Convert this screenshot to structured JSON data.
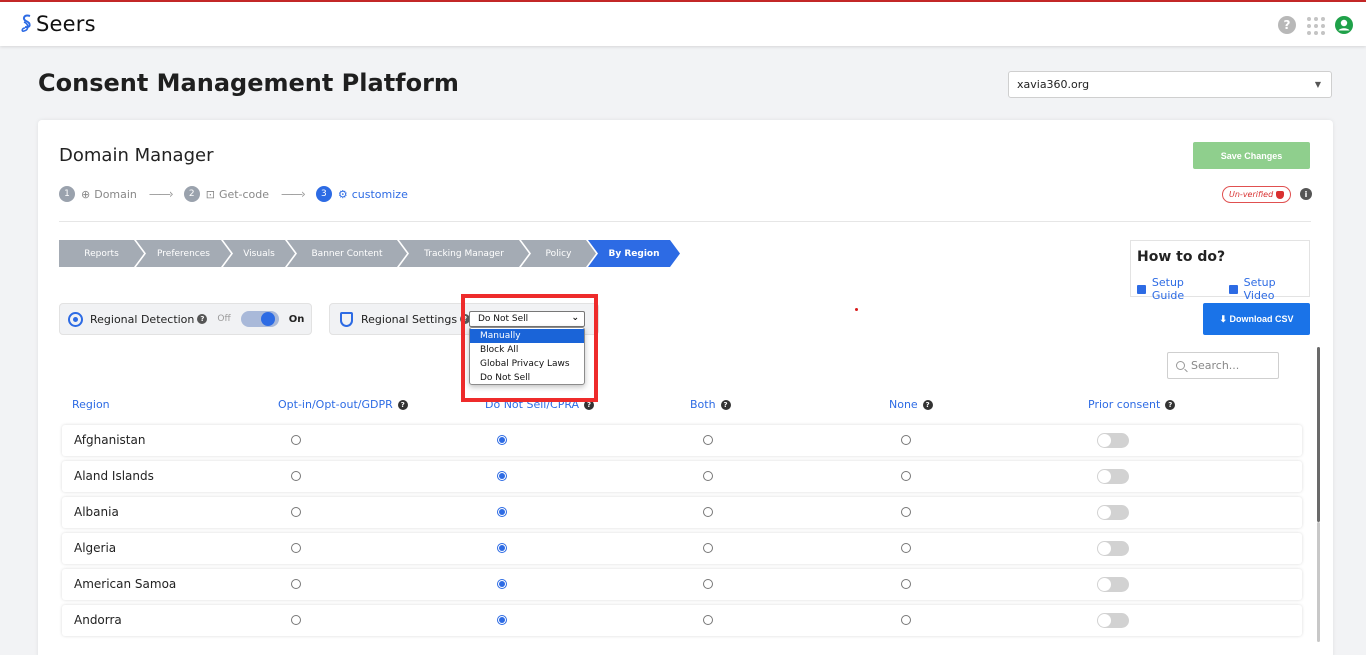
{
  "app": {
    "logo_text": "Seers"
  },
  "header": {
    "title": "Consent Management Platform",
    "domain_value": "xavia360.org"
  },
  "card": {
    "title": "Domain Manager",
    "save_label": "Save Changes",
    "status_badge": "Un-verified",
    "steps": [
      {
        "num": "1",
        "label": "Domain"
      },
      {
        "num": "2",
        "label": "Get-code"
      },
      {
        "num": "3",
        "label": "customize"
      }
    ],
    "tabs": [
      "Reports",
      "Preferences",
      "Visuals",
      "Banner Content",
      "Tracking Manager",
      "Policy",
      "By Region"
    ],
    "active_tab": "By Region"
  },
  "howto": {
    "title": "How to do?",
    "guide_label": "Setup Guide",
    "video_label": "Setup Video"
  },
  "download_label": "Download CSV",
  "regional_detection": {
    "label": "Regional Detection",
    "off_label": "Off",
    "on_label": "On",
    "state": "On"
  },
  "regional_settings": {
    "label": "Regional Settings",
    "selected": "Do Not Sell",
    "options": [
      "Manually",
      "Block All",
      "Global Privacy Laws",
      "Do Not Sell"
    ],
    "highlighted_option": "Manually"
  },
  "search": {
    "placeholder": "Search..."
  },
  "table": {
    "columns": [
      "Region",
      "Opt-in/Opt-out/GDPR",
      "Do Not Sell/CPRA",
      "Both",
      "None",
      "Prior consent"
    ],
    "rows": [
      {
        "region": "Afghanistan",
        "selected": "Do Not Sell/CPRA",
        "prior_consent": false
      },
      {
        "region": "Aland Islands",
        "selected": "Do Not Sell/CPRA",
        "prior_consent": false
      },
      {
        "region": "Albania",
        "selected": "Do Not Sell/CPRA",
        "prior_consent": false
      },
      {
        "region": "Algeria",
        "selected": "Do Not Sell/CPRA",
        "prior_consent": false
      },
      {
        "region": "American Samoa",
        "selected": "Do Not Sell/CPRA",
        "prior_consent": false
      },
      {
        "region": "Andorra",
        "selected": "Do Not Sell/CPRA",
        "prior_consent": false
      }
    ]
  },
  "colors": {
    "accent": "#2d6be4",
    "save_button": "#8fcf8d",
    "highlight": "#ee2b2b",
    "top_line": "#c62828"
  }
}
